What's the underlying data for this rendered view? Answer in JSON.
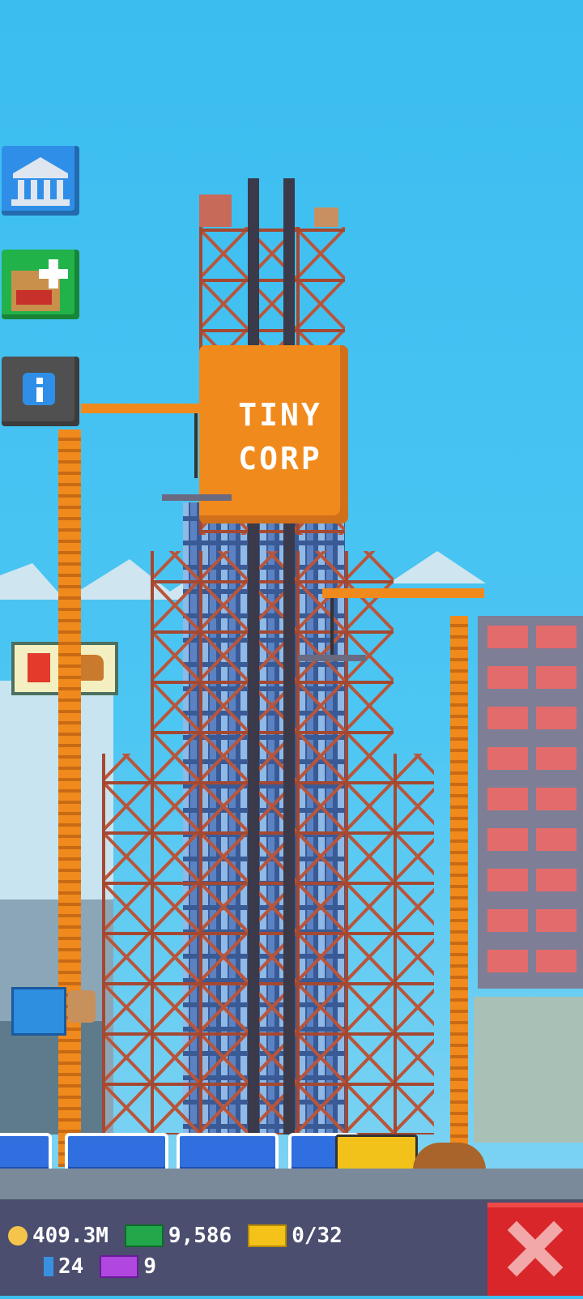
{
  "tower_sign": {
    "line1": "TINY",
    "line2": "CORP"
  },
  "side_buttons": [
    {
      "name": "bank-button",
      "icon": "bank-icon",
      "color": "#2f8fe8"
    },
    {
      "name": "build-floor-button",
      "icon": "build-floor-icon",
      "color": "#22b24a"
    },
    {
      "name": "info-button",
      "icon": "info-icon",
      "color": "#505050"
    }
  ],
  "hud": {
    "coins": "409.3M",
    "bux": "9,586",
    "tickets": "0/32",
    "gems": "24",
    "vip": "9"
  },
  "colors": {
    "sky": "#3bbdf0",
    "crane": "#f08a1c",
    "scaffold": "#c05a3a",
    "close": "#d8262a"
  }
}
